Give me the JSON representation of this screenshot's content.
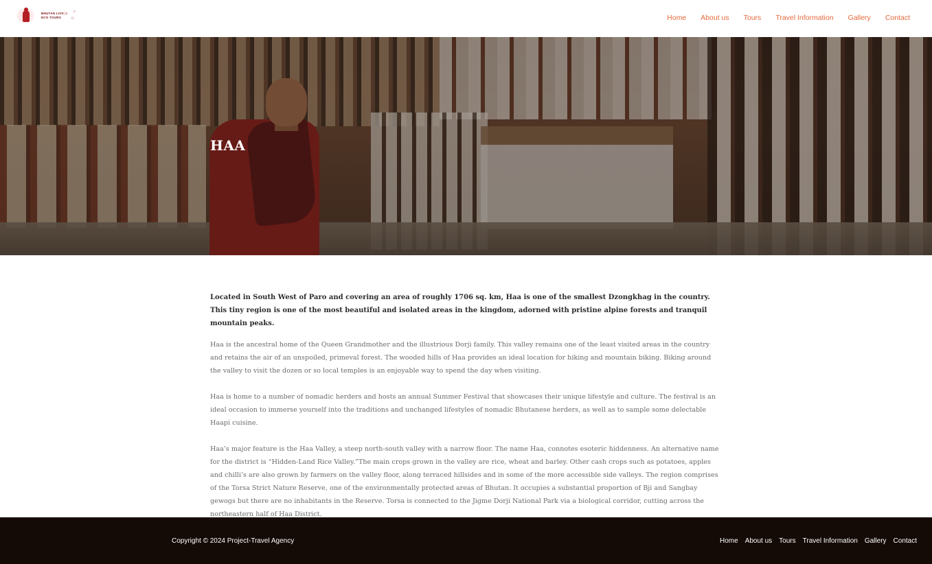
{
  "header": {
    "logo": {
      "line1": "BHUTAN LIVING",
      "line2": "ECO TOURS"
    },
    "nav": [
      {
        "label": "Home"
      },
      {
        "label": "About us"
      },
      {
        "label": "Tours"
      },
      {
        "label": "Travel Information"
      },
      {
        "label": "Gallery"
      },
      {
        "label": "Contact"
      }
    ]
  },
  "hero": {
    "title": "HAA"
  },
  "content": {
    "lead": "Located in South West of Paro and covering an area of roughly 1706 sq. km, Haa is one of the smallest Dzongkhag in the country. This tiny region is one of the most beautiful and isolated areas in the kingdom, adorned with pristine alpine forests and tranquil mountain peaks.",
    "paragraphs": [
      "Haa is the ancestral home of the Queen Grandmother and the illustrious Dorji family. This valley remains one of the least visited areas in the country and retains the air of an unspoiled, primeval forest. The wooded hills of Haa provides an ideal location for hiking and mountain biking. Biking around the valley to visit the dozen or so local temples is an enjoyable way to spend the day when visiting.",
      "Haa is home to a number of nomadic herders and hosts an annual Summer Festival that showcases their unique lifestyle and culture. The festival is an ideal occasion to immerse yourself into the traditions and unchanged lifestyles of nomadic Bhutanese herders, as well as to sample some delectable Haapi cuisine.",
      "Haa’s major feature is the Haa Valley, a steep north-south valley with a narrow floor. The name Haa, connotes esoteric hiddenness. An alternative name for the district is “Hidden-Land Rice Valley.”The main crops grown in the valley are rice, wheat and barley. Other cash crops such as potatoes, apples and chilli’s are also grown by farmers on the valley floor, along terraced hillsides and in some of the more accessible side valleys. The region comprises of the Torsa Strict Nature Reserve, one of the environmentally protected areas of Bhutan. It occupies a substantial proportion of Bji and Sangbay gewogs but there are no inhabitants in the Reserve. Torsa is connected to the Jigme Dorji National Park via a biological corridor, cutting across the northeastern half of Haa District."
    ]
  },
  "footer": {
    "copyright": "Copyright © 2024 Project-Travel Agency",
    "nav": [
      {
        "label": "Home"
      },
      {
        "label": "About us"
      },
      {
        "label": "Tours"
      },
      {
        "label": "Travel Information"
      },
      {
        "label": "Gallery"
      },
      {
        "label": "Contact"
      }
    ]
  },
  "colors": {
    "nav_accent": "#e4683a",
    "footer_bg": "#140b07",
    "logo_red": "#b21e24"
  }
}
